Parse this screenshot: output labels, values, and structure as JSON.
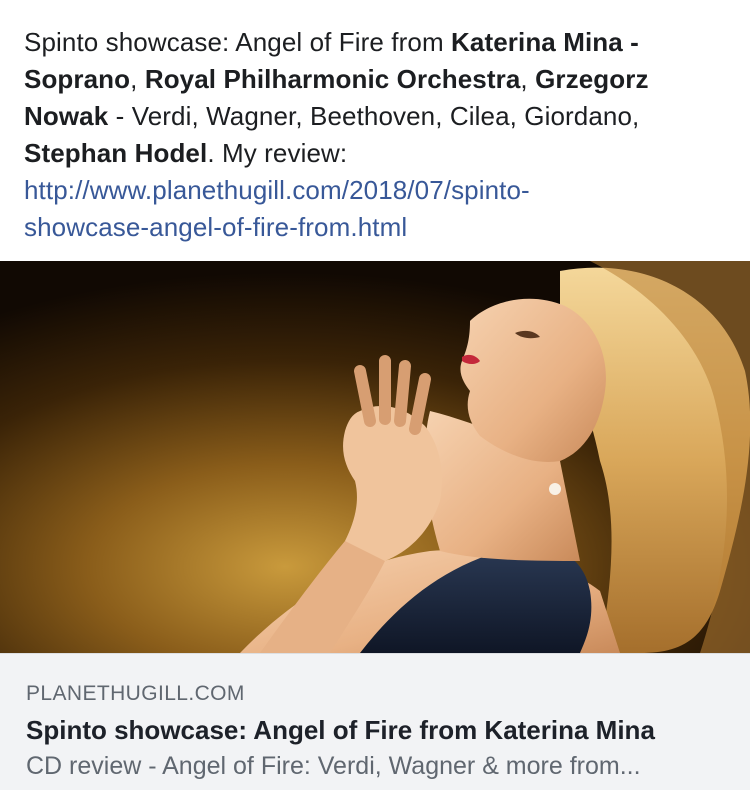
{
  "post": {
    "t1": "Spinto showcase: Angel of Fire from ",
    "b1": "Katerina Mina - Soprano",
    "t2": ", ",
    "b2": "Royal Philharmonic Orchestra",
    "t3": ",  ",
    "b3": "Grzegorz Nowak",
    "t4": " - Verdi, Wagner, Beethoven, Cilea, Giordano, ",
    "b4": "Stephan Hodel",
    "t5": ". My review:",
    "link": "http://www.planethugill.com/2018/07/spinto-showcase-angel-of-fire-from.html",
    "link_line1": "http://www.planethugill.com/2018/07/spinto-",
    "link_line2": "showcase-angel-of-fire-from.html"
  },
  "link_card": {
    "domain": "PLANETHUGILL.COM",
    "title": "Spinto showcase: Angel of Fire from Katerina Mina",
    "description": "CD review - Angel of Fire: Verdi, Wagner & more from..."
  },
  "colors": {
    "link": "#385898",
    "card_bg": "#f2f3f5",
    "muted_text": "#606770"
  }
}
